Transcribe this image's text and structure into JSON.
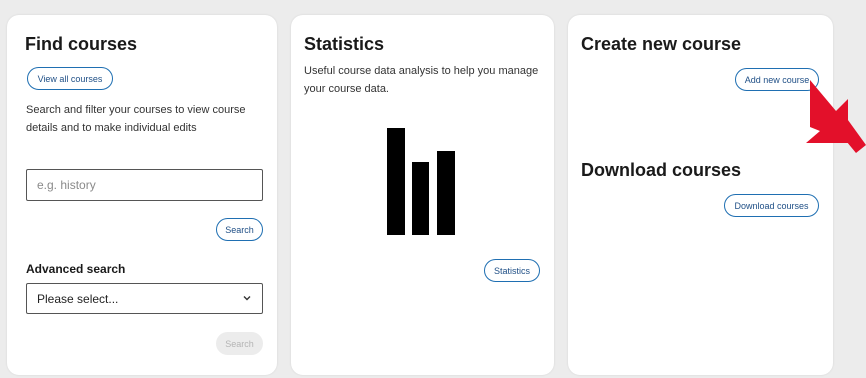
{
  "find_courses": {
    "title": "Find courses",
    "view_all_label": "View all courses",
    "description": "Search and filter your courses to view course details and to make individual edits",
    "search_placeholder": "e.g. history",
    "search_label": "Search",
    "advanced_title": "Advanced search",
    "advanced_select_value": "Please select...",
    "advanced_search_label": "Search"
  },
  "statistics": {
    "title": "Statistics",
    "description": "Useful course data analysis to help you manage your course data.",
    "button_label": "Statistics",
    "icon": "bar-chart-icon"
  },
  "create_course": {
    "title": "Create new course",
    "button_label": "Add new course"
  },
  "download_courses": {
    "title": "Download courses",
    "button_label": "Download courses"
  },
  "annotation": {
    "icon": "red-arrow-icon",
    "color": "#e3102a"
  },
  "colors": {
    "page_background": "#ececec",
    "card_background": "#ffffff",
    "button_border": "#1f6fb2",
    "disabled_button": "#ececec"
  }
}
